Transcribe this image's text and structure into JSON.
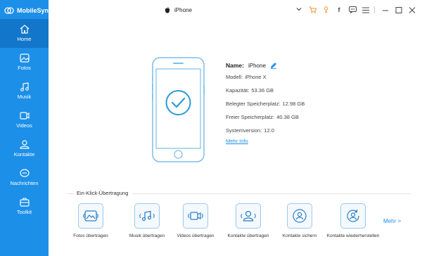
{
  "app": {
    "title": "MobileSync"
  },
  "device_select": {
    "value": "iPhone"
  },
  "top_icons": [
    "cart-icon",
    "key-icon",
    "facebook-icon",
    "chat-icon",
    "menu-icon",
    "minimize-icon",
    "maximize-icon",
    "close-icon"
  ],
  "sidebar": {
    "items": [
      {
        "label": "Home",
        "icon": "home-icon",
        "active": true
      },
      {
        "label": "Fotos",
        "icon": "photo-icon"
      },
      {
        "label": "Musik",
        "icon": "music-icon"
      },
      {
        "label": "Videos",
        "icon": "video-icon"
      },
      {
        "label": "Kontakte",
        "icon": "contacts-icon"
      },
      {
        "label": "Nachrichten",
        "icon": "messages-icon"
      },
      {
        "label": "Toolkit",
        "icon": "toolkit-icon"
      }
    ]
  },
  "device": {
    "name_label": "Name:",
    "name_value": "iPhone",
    "model_label": "Modell:",
    "model_value": "iPhone X",
    "capacity_label": "Kapazität:",
    "capacity_value": "53.36 GB",
    "used_label": "Belegter Speicherplatz:",
    "used_value": "12.98 GB",
    "free_label": "Freier Speicherplatz:",
    "free_value": "40.38 GB",
    "version_label": "Systemversion:",
    "version_value": "12.0",
    "more_info": "Mehr Info"
  },
  "one_click": {
    "title": "Ein-Klick-Übertragung",
    "tools": [
      {
        "label": "Fotos übertragen"
      },
      {
        "label": "Musik übertragen"
      },
      {
        "label": "Videos übertragen"
      },
      {
        "label": "Kontakte übertragen"
      },
      {
        "label": "Kontakte sichern"
      },
      {
        "label": "Kontakte wiederherstellen"
      }
    ],
    "more": "Mehr >"
  },
  "colors": {
    "accent": "#1c8fe8",
    "sidebar_active": "#1277cb",
    "check": "#2a9ad8"
  }
}
